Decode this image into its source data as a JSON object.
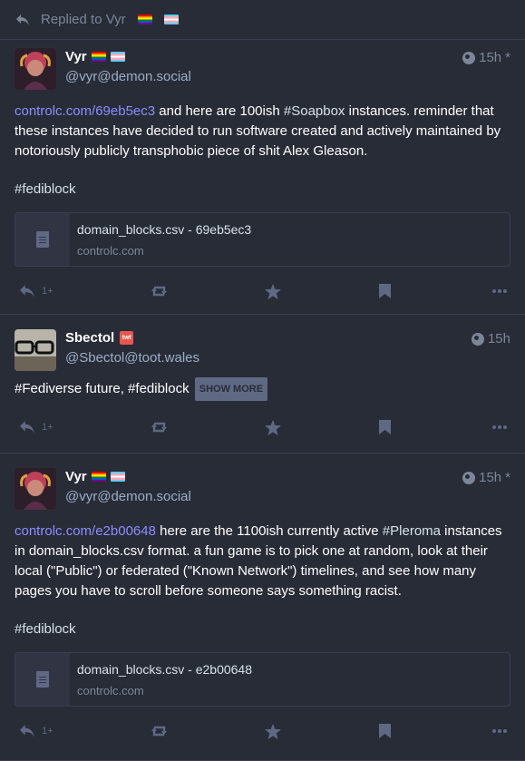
{
  "replied": {
    "text": "Replied to Vyr"
  },
  "posts": [
    {
      "name": "Vyr",
      "handle": "@vyr@demon.social",
      "time": "15h",
      "edited": "*",
      "link": "controlc.com/69eb5ec3",
      "text_1": " and here are 100ish ",
      "tag_1": "#Soapbox",
      "text_2": " instances. reminder that these instances have decided to run software created and actively maintained by notoriously publicly transphobic piece of shit Alex Gleason.",
      "hashtag": "#fediblock",
      "card": {
        "title": "domain_blocks.csv - 69eb5ec3",
        "host": "controlc.com"
      },
      "reply_count": "1+"
    },
    {
      "name": "Sbectol",
      "badge": "twt",
      "handle": "@Sbectol@toot.wales",
      "time": "15h",
      "text": "#Fediverse future, #fediblock",
      "show_more": "SHOW MORE",
      "reply_count": "1+"
    },
    {
      "name": "Vyr",
      "handle": "@vyr@demon.social",
      "time": "15h",
      "edited": "*",
      "link": "controlc.com/e2b00648",
      "text_1": " here are the 1100ish currently active ",
      "tag_1": "#Pleroma",
      "text_2": " instances in domain_blocks.csv format. a fun game is to pick one at random, look at their local (\"Public\") or federated (\"Known Network\") timelines, and see how many pages you have to scroll before someone says something racist.",
      "hashtag": "#fediblock",
      "card": {
        "title": "domain_blocks.csv - e2b00648",
        "host": "controlc.com"
      },
      "reply_count": "1+"
    }
  ],
  "colors": {
    "background": "#282c37",
    "link": "#8c8dff",
    "muted": "#606984"
  }
}
